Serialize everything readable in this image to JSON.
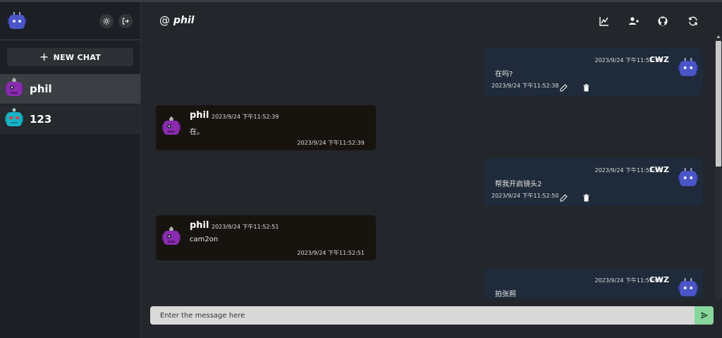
{
  "colors": {
    "sidebar_bg": "#1c1f24",
    "main_bg": "#23262b",
    "own_message_bg": "#1f2a3a",
    "other_message_bg": "#17140f",
    "send_button_bg": "#88d69c"
  },
  "sidebar": {
    "new_chat_label": "NEW CHAT",
    "theme_icon": "sun-icon",
    "logout_icon": "logout-icon",
    "rooms": [
      {
        "name": "phil",
        "avatar": "purple-robot"
      },
      {
        "name": "123",
        "avatar": "teal-robot"
      }
    ]
  },
  "header": {
    "at_symbol": "@",
    "title": "phil",
    "icons": [
      "chart-icon",
      "add-user-icon",
      "github-icon",
      "refresh-icon"
    ]
  },
  "messages": [
    {
      "side": "right",
      "user": "CWZ",
      "time": "2023/9/24 下午11:52:38",
      "text": "在吗?",
      "footer_time": "2023/9/24 下午11:52:38"
    },
    {
      "side": "left",
      "user": "phil",
      "time": "2023/9/24 下午11:52:39",
      "text": "在。",
      "footer_time": "2023/9/24 下午11:52:39"
    },
    {
      "side": "right",
      "user": "CWZ",
      "time": "2023/9/24 下午11:52:50",
      "text": "帮我开启镜头2",
      "footer_time": "2023/9/24 下午11:52:50"
    },
    {
      "side": "left",
      "user": "phil",
      "time": "2023/9/24 下午11:52:51",
      "text": "cam2on",
      "footer_time": "2023/9/24 下午11:52:51"
    },
    {
      "side": "right",
      "user": "CWZ",
      "time": "2023/9/24 下午11:53:08",
      "text": "拍张照",
      "footer_time": ""
    }
  ],
  "input": {
    "placeholder": "Enter the message here"
  }
}
